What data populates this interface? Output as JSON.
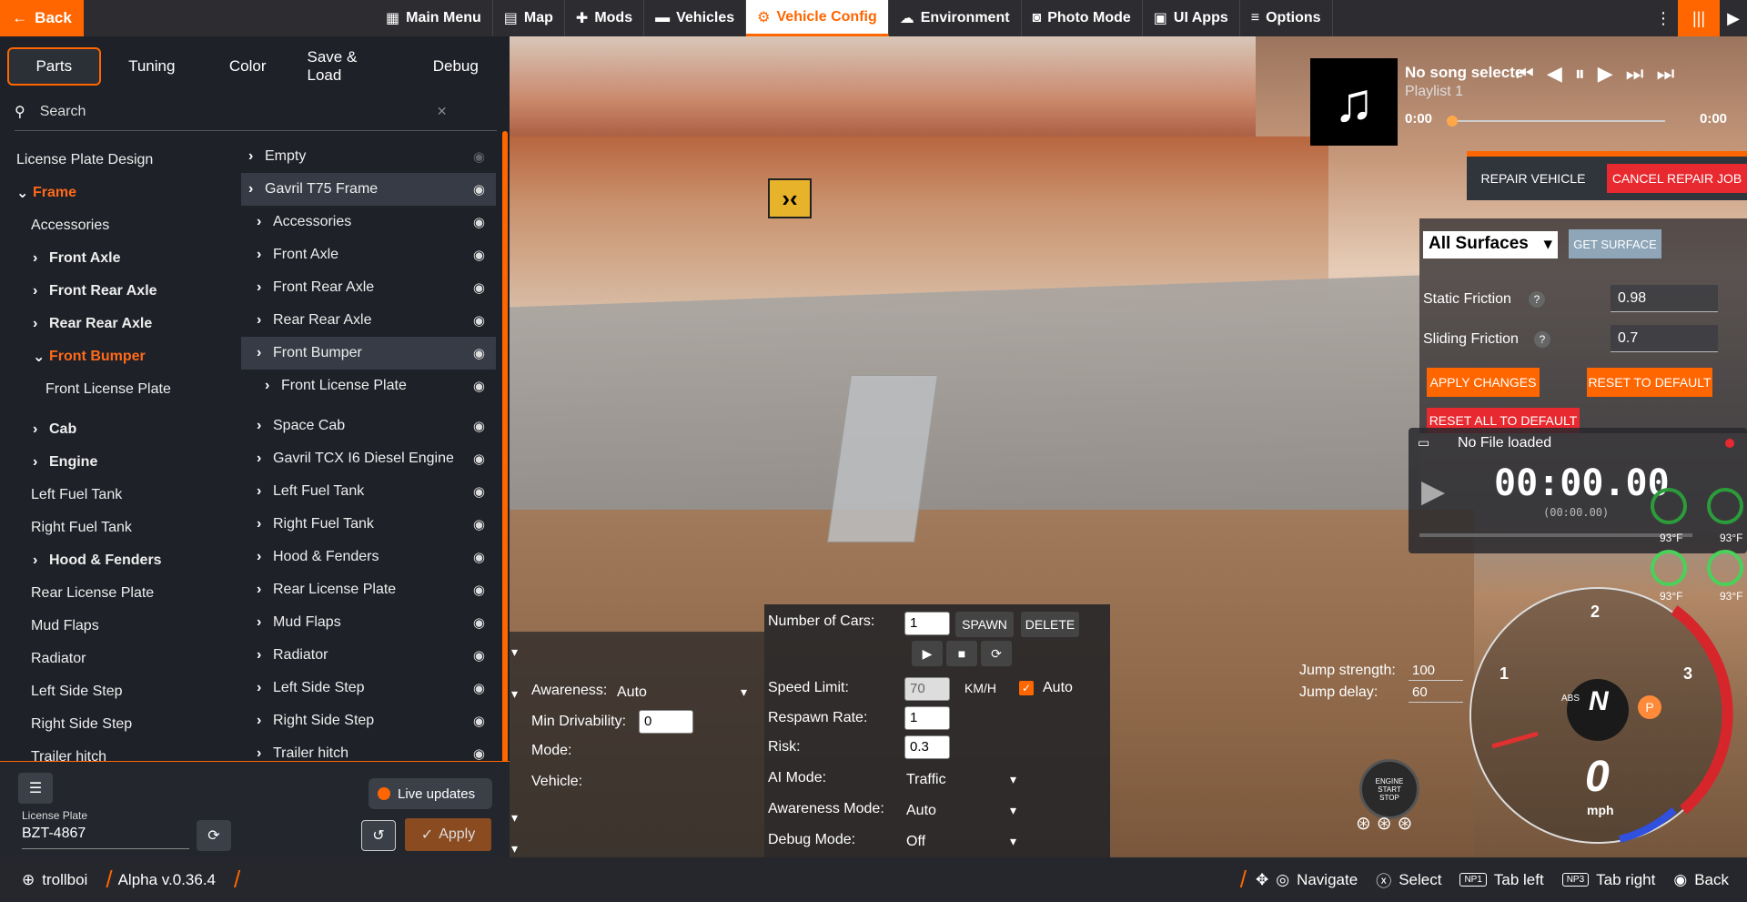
{
  "topbar": {
    "back": "Back",
    "items": [
      {
        "label": "Main Menu",
        "icon": "menu-icon"
      },
      {
        "label": "Map",
        "icon": "map-icon"
      },
      {
        "label": "Mods",
        "icon": "puzzle-icon"
      },
      {
        "label": "Vehicles",
        "icon": "car-icon"
      },
      {
        "label": "Vehicle Config",
        "icon": "engine-icon",
        "active": true
      },
      {
        "label": "Environment",
        "icon": "weather-icon"
      },
      {
        "label": "Photo Mode",
        "icon": "camera-icon"
      },
      {
        "label": "UI Apps",
        "icon": "apps-icon"
      },
      {
        "label": "Options",
        "icon": "sliders-icon"
      }
    ]
  },
  "tabs": [
    "Parts",
    "Tuning",
    "Color",
    "Save & Load",
    "Debug"
  ],
  "search": {
    "placeholder": "Search"
  },
  "slots": [
    {
      "label": "License Plate Design",
      "style": "plain",
      "indent": 0
    },
    {
      "label": "Frame",
      "style": "orange",
      "indent": 0,
      "chev": "down"
    },
    {
      "label": "Accessories",
      "style": "plain",
      "indent": 1
    },
    {
      "label": "Front Axle",
      "style": "bold",
      "indent": 1,
      "chev": "right"
    },
    {
      "label": "Front Rear Axle",
      "style": "bold",
      "indent": 1,
      "chev": "right"
    },
    {
      "label": "Rear Rear Axle",
      "style": "bold",
      "indent": 1,
      "chev": "right"
    },
    {
      "label": "Front Bumper",
      "style": "orange",
      "indent": 1,
      "chev": "down"
    },
    {
      "label": "Front License Plate",
      "style": "plain",
      "indent": 2
    },
    {
      "label": "Cab",
      "style": "bold",
      "indent": 1,
      "chev": "right"
    },
    {
      "label": "Engine",
      "style": "bold",
      "indent": 1,
      "chev": "right"
    },
    {
      "label": "Left Fuel Tank",
      "style": "plain",
      "indent": 1
    },
    {
      "label": "Right Fuel Tank",
      "style": "plain",
      "indent": 1
    },
    {
      "label": "Hood & Fenders",
      "style": "bold",
      "indent": 1,
      "chev": "right"
    },
    {
      "label": "Rear License Plate",
      "style": "plain",
      "indent": 1
    },
    {
      "label": "Mud Flaps",
      "style": "plain",
      "indent": 1
    },
    {
      "label": "Radiator",
      "style": "plain",
      "indent": 1
    },
    {
      "label": "Left Side Step",
      "style": "plain",
      "indent": 1
    },
    {
      "label": "Right Side Step",
      "style": "plain",
      "indent": 1
    },
    {
      "label": "Trailer hitch",
      "style": "plain",
      "indent": 1
    }
  ],
  "parts": [
    {
      "label": "Empty",
      "indent": 0,
      "hl": false
    },
    {
      "label": "Gavril T75 Frame",
      "indent": 0,
      "hl": true
    },
    {
      "label": "Accessories",
      "indent": 1,
      "hl": false
    },
    {
      "label": "Front Axle",
      "indent": 1,
      "hl": false
    },
    {
      "label": "Front Rear Axle",
      "indent": 1,
      "hl": false
    },
    {
      "label": "Rear Rear Axle",
      "indent": 1,
      "hl": false
    },
    {
      "label": "Front Bumper",
      "indent": 1,
      "hl": true
    },
    {
      "label": "Front License Plate",
      "indent": 2,
      "hl": false
    },
    {
      "label": "Space Cab",
      "indent": 1,
      "hl": false
    },
    {
      "label": "Gavril TCX I6 Diesel Engine",
      "indent": 1,
      "hl": false
    },
    {
      "label": "Left Fuel Tank",
      "indent": 1,
      "hl": false
    },
    {
      "label": "Right Fuel Tank",
      "indent": 1,
      "hl": false
    },
    {
      "label": "Hood & Fenders",
      "indent": 1,
      "hl": false
    },
    {
      "label": "Rear License Plate",
      "indent": 1,
      "hl": false
    },
    {
      "label": "Mud Flaps",
      "indent": 1,
      "hl": false
    },
    {
      "label": "Radiator",
      "indent": 1,
      "hl": false
    },
    {
      "label": "Left Side Step",
      "indent": 1,
      "hl": false
    },
    {
      "label": "Right Side Step",
      "indent": 1,
      "hl": false
    },
    {
      "label": "Trailer hitch",
      "indent": 1,
      "hl": false
    }
  ],
  "leftbottom": {
    "live_updates": "Live updates",
    "plate_label": "License Plate",
    "plate_value": "BZT-4867",
    "apply": "Apply"
  },
  "music": {
    "title": "No song selecte",
    "playlist": "Playlist 1",
    "time_start": "0:00",
    "time_end": "0:00"
  },
  "repair": {
    "repair": "REPAIR VEHICLE",
    "cancel": "CANCEL REPAIR JOB"
  },
  "surface": {
    "select": "All Surfaces",
    "get": "GET SURFACE",
    "static_label": "Static Friction",
    "static_value": "0.98",
    "sliding_label": "Sliding Friction",
    "sliding_value": "0.7",
    "apply": "APPLY CHANGES",
    "reset": "RESET TO DEFAULT",
    "reset_all": "RESET ALL TO DEFAULT"
  },
  "replay": {
    "file": "No File loaded",
    "time": "00:00.00",
    "sub": "(00:00.00)"
  },
  "temps": [
    "93°F",
    "93°F",
    "93°F",
    "93°F"
  ],
  "traffic": {
    "num_cars_label": "Number of Cars:",
    "num_cars": "1",
    "spawn": "SPAWN",
    "delete": "DELETE",
    "speed_label": "Speed Limit:",
    "speed": "70",
    "unit": "KM/H",
    "auto": "Auto",
    "respawn_label": "Respawn Rate:",
    "respawn": "1",
    "risk_label": "Risk:",
    "risk": "0.3",
    "ai_mode_label": "AI Mode:",
    "ai_mode": "Traffic",
    "awareness_mode_label": "Awareness Mode:",
    "awareness_mode": "Auto",
    "debug_label": "Debug Mode:",
    "debug": "Off"
  },
  "ai": {
    "awareness_label": "Awareness:",
    "awareness": "Auto",
    "min_label": "Min Drivability:",
    "min": "0",
    "mode_label": "Mode:",
    "vehicle_label": "Vehicle:"
  },
  "jump": {
    "strength_label": "Jump strength:",
    "strength": "100",
    "delay_label": "Jump delay:",
    "delay": "60"
  },
  "gauge": {
    "gear": "N",
    "park": "P",
    "speed": "0",
    "unit": "mph",
    "abs": "ABS",
    "ticks": [
      "1",
      "2",
      "3"
    ],
    "engine": [
      "ENGINE",
      "START",
      "STOP"
    ]
  },
  "bottombar": {
    "user": "trollboi",
    "version": "Alpha v.0.36.4",
    "navigate": "Navigate",
    "select": "Select",
    "np1": "NP1",
    "tab_left": "Tab left",
    "np3": "NP3",
    "tab_right": "Tab right",
    "back": "Back"
  },
  "colors": {
    "accent": "#ff6600",
    "red": "#e8292f"
  }
}
